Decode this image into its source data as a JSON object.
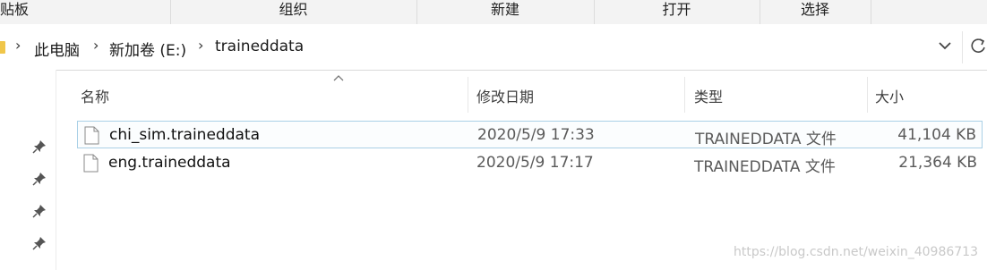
{
  "ribbon": {
    "groups": [
      "贴板",
      "组织",
      "新建",
      "打开",
      "选择"
    ]
  },
  "address": {
    "crumbs": [
      "此电脑",
      "新加卷 (E:)",
      "traineddata"
    ]
  },
  "columns": {
    "name": "名称",
    "date": "修改日期",
    "type": "类型",
    "size": "大小"
  },
  "files": [
    {
      "name": "chi_sim.traineddata",
      "date": "2020/5/9 17:33",
      "type": "TRAINEDDATA 文件",
      "size": "41,104 KB",
      "selected": true
    },
    {
      "name": "eng.traineddata",
      "date": "2020/5/9 17:17",
      "type": "TRAINEDDATA 文件",
      "size": "21,364 KB",
      "selected": false
    }
  ],
  "watermark": "https://blog.csdn.net/weixin_40986713",
  "colors": {
    "folder": "#f0c64a",
    "selection_border": "#a9d0e6",
    "ribbon_bg": "#f3f3f3"
  }
}
